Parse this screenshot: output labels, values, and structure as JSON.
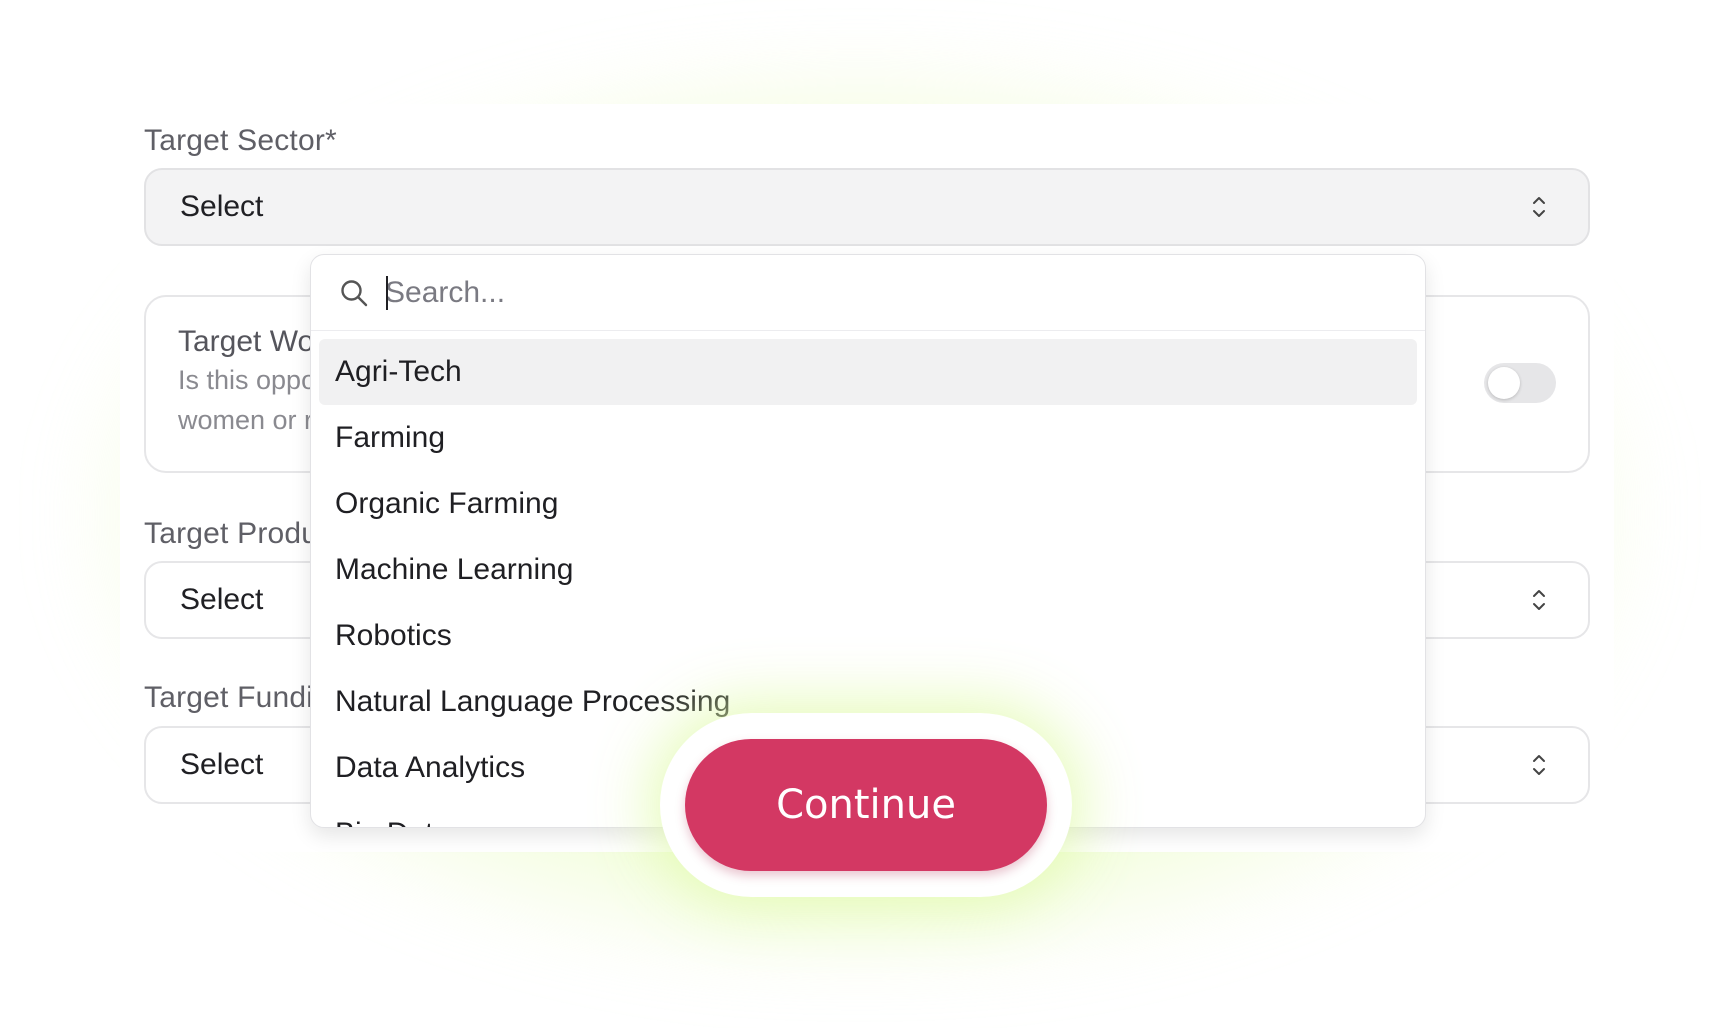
{
  "form": {
    "sector": {
      "label": "Target Sector*",
      "value": "Select"
    },
    "women_toggle": {
      "title": "Target Wo",
      "description_line1": "Is this oppo",
      "description_line2": "women or r",
      "enabled": false
    },
    "product": {
      "label": "Target Produ",
      "value": "Select"
    },
    "funding": {
      "label": "Target Fundi",
      "value": "Select"
    }
  },
  "dropdown": {
    "search_placeholder": "Search...",
    "highlighted_index": 0,
    "options": [
      "Agri-Tech",
      "Farming",
      "Organic Farming",
      "Machine Learning",
      "Robotics",
      "Natural Language Processing",
      "Data Analytics",
      "Big Data"
    ]
  },
  "actions": {
    "continue_label": "Continue"
  },
  "icons": {
    "search": "search-icon",
    "select_chevrons": "chevron-up-down-icon"
  },
  "colors": {
    "accent": "#d33863",
    "glow": "#e4fbb8",
    "highlight_row": "#f1f1f2"
  }
}
